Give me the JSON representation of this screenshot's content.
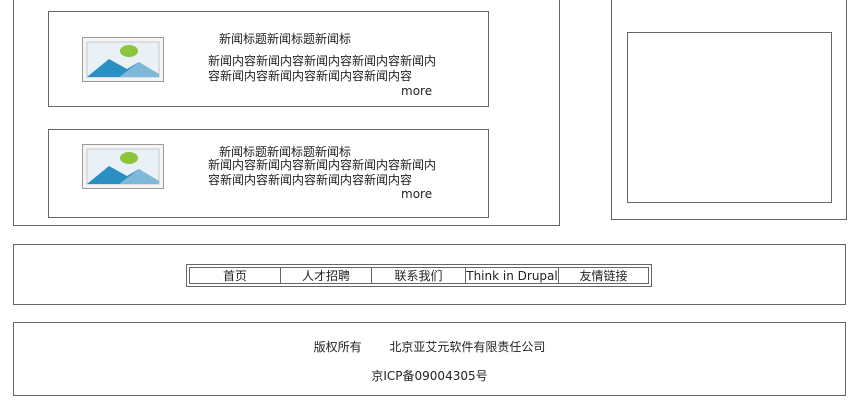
{
  "news": [
    {
      "title": "新闻标题新闻标题新闻标",
      "body": "新闻内容新闻内容新闻内容新闻内容新闻内容新闻内容新闻内容新闻内容新闻内容",
      "more": "more"
    },
    {
      "title": "新闻标题新闻标题新闻标",
      "body": "新闻内容新闻内容新闻内容新闻内容新闻内容新闻内容新闻内容新闻内容新闻内容",
      "more": "more"
    }
  ],
  "nav": {
    "items": [
      "首页",
      "人才招聘",
      "联系我们",
      "Think in Drupal",
      "友情链接"
    ]
  },
  "footer": {
    "copyright": "版权所有",
    "company": "北京亚艾元软件有限责任公司",
    "icp": "京ICP备09004305号"
  }
}
